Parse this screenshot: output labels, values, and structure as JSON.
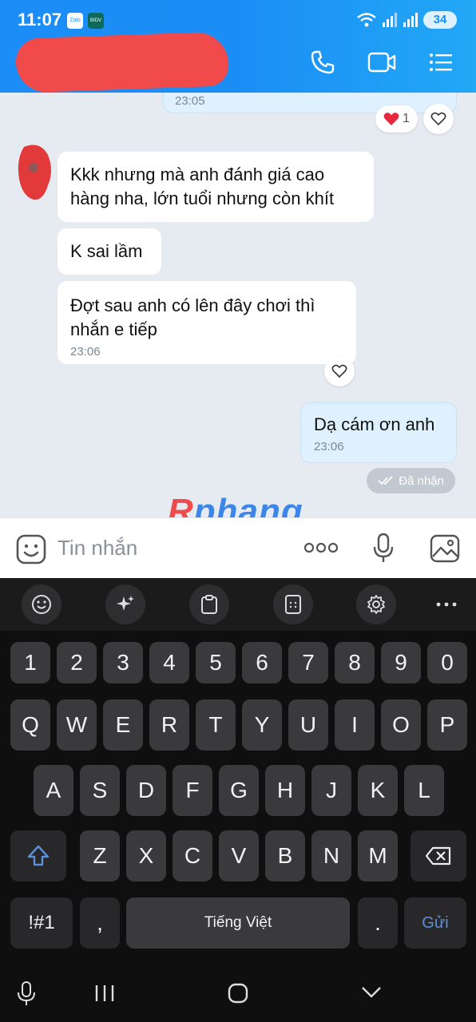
{
  "status_bar": {
    "time": "11:07",
    "app_icons": [
      "Zalo",
      "BIDV"
    ],
    "battery": "34"
  },
  "header": {
    "contact_name_redacted": true,
    "call_icon": "phone-icon",
    "video_icon": "video-call-icon",
    "menu_icon": "menu-icon"
  },
  "messages": [
    {
      "direction": "sent",
      "time": "23:05",
      "reaction": {
        "emoji": "heart",
        "count": "1"
      }
    },
    {
      "direction": "received",
      "text": "Kkk nhưng mà anh đánh giá cao hàng nha, lớn tuổi nhưng còn khít"
    },
    {
      "direction": "received",
      "text": "K sai lầm"
    },
    {
      "direction": "received",
      "text": "Đợt sau anh có lên đây chơi thì nhắn e tiếp",
      "time": "23:06"
    },
    {
      "direction": "sent",
      "text": "Dạ cám ơn anh",
      "time": "23:06"
    }
  ],
  "delivery_status": "Đã nhận",
  "watermark": {
    "r": "R",
    "rest": "phang"
  },
  "input": {
    "placeholder": "Tin nhắn"
  },
  "keyboard": {
    "number_row": [
      "1",
      "2",
      "3",
      "4",
      "5",
      "6",
      "7",
      "8",
      "9",
      "0"
    ],
    "row1": [
      "Q",
      "W",
      "E",
      "R",
      "T",
      "Y",
      "U",
      "I",
      "O",
      "P"
    ],
    "row2": [
      "A",
      "S",
      "D",
      "F",
      "G",
      "H",
      "J",
      "K",
      "L"
    ],
    "row3": [
      "Z",
      "X",
      "C",
      "V",
      "B",
      "N",
      "M"
    ],
    "symbols_label": "!#1",
    "comma": ",",
    "space_label": "Tiếng Việt",
    "period": ".",
    "send_label": "Gửi",
    "toolbar": [
      "emoji-icon",
      "ai-sparkle-icon",
      "clipboard-icon",
      "keypad-icon",
      "settings-icon",
      "more-icon"
    ]
  },
  "colors": {
    "header": "#1a8ef5",
    "chat_bg": "#e6ebf2",
    "sent_bubble": "#dff1ff",
    "keyboard_bg": "#0f0f10"
  }
}
